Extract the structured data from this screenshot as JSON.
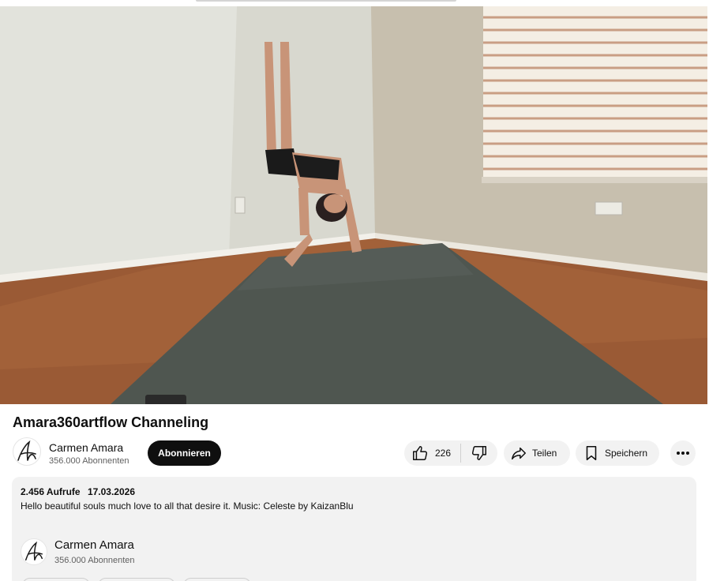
{
  "video": {
    "title": "Amara360artflow Channeling"
  },
  "channel": {
    "name": "Carmen Amara",
    "subscribers": "356.000 Abonnenten",
    "avatar_icon": "signature-logo-icon"
  },
  "actions": {
    "subscribe_label": "Abonnieren",
    "like_count": "226",
    "like_icon": "thumb-up-icon",
    "dislike_icon": "thumb-down-icon",
    "share_label": "Teilen",
    "share_icon": "share-arrow-icon",
    "save_label": "Speichern",
    "save_icon": "bookmark-icon",
    "more_icon": "more-horizontal-icon"
  },
  "description": {
    "views": "2.456 Aufrufe",
    "date": "17.03.2026",
    "text": "Hello beautiful souls much love to all that desire it. Music: Celeste by KaizanBlu",
    "channel_name": "Carmen Amara",
    "channel_subscribers": "356.000 Abonnenten"
  },
  "colors": {
    "subscribe_bg": "#0f0f0f",
    "pill_bg": "#f2f2f2",
    "description_bg": "#f2f2f2"
  }
}
